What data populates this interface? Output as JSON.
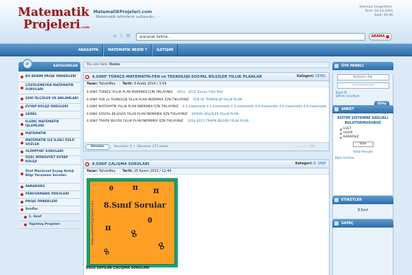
{
  "header": {
    "logo_line1": "Matematik",
    "logo_line2": "Projeleri",
    "logo_domain": ".com",
    "site_name": "MatematikProjeleri.com",
    "tagline": "- Matematik bilimlerin sultanıdır... -",
    "search_placeholder": "aranacak kelime...",
    "search_button": "ARAMA",
    "welcome": "Sitemize hoşgeldiniz.",
    "date": "Tarih: 04-24-2016",
    "time": "Saat: 04:46"
  },
  "nav": [
    "ANASAYFA",
    "MATEMATİK NEDİR ?",
    "İLETİŞİM"
  ],
  "left_panel": {
    "title": "KATEGORİLER",
    "items": [
      "BU BENİM PROJE ÖRNEKLERİ",
      "ÇÖZÜLEMEYEN MATEMATİK SORULARI",
      "ESKİ ÖLÇÜLER VE ANLAMLARI",
      "EVYAP KOLEJİ ÖDEVLERİ",
      "GENEL",
      "İLGİNÇ MATEMATİK İŞLEMLERİ",
      "MATEMATİK",
      "MATEMATİK İLE İLGİLİ ÖZLÜ SÖZLER",
      "OLİMPİYAT SORULARI",
      "ÖZEL MÜKÜVVET EVYAP KOLEJİ",
      "Özel Mürüvvet Evyap Koleji Bilgi Yarışması Soruları",
      "PARADOKS",
      "PERFORMANS ÖDEVLERİ",
      "PROJE ÖRNEKLERİ",
      "Sınıflar",
      "1. Sınıf",
      "Yapılmış Projeleri"
    ]
  },
  "breadcrumb": {
    "prefix": "You are here:",
    "home": "Home"
  },
  "post1": {
    "title": "4.SINIF TÜRKÇE-MATEMATİK-FEN ve TEKNOLOJİ-SOSYAL BİLGİLER YILLIK PLANLAR",
    "category_label": "Kategori:",
    "category": "GENEL",
    "author_label": "Yazar:",
    "author": "TahsinBey",
    "date_label": "Tarih:",
    "date": "9 Aralık 2014 / 1:54",
    "lines": [
      {
        "text": "4.SINIF TÜRKÇE YILLIK PLAN İNDİRMEK İÇİN TIKLAYINIZ",
        "link": "2014 - 2015 Türkçe Yıllık Plan"
      },
      {
        "text": "4.SINIF FEN ve TEKNOLOJİ YILLIK PLAN İNDİRMEK İÇİN TIKLAYINIZ",
        "link": "FEN VE TEKNOLOJİ YILLIK PLAN"
      },
      {
        "text": "4.SINIF MATEMATİK YILLIK PLAN İNDİRMEK İÇİN TIKLAYINIZ",
        "link": "4.1.matematik 4.2.matematik 4.3.matematik 4.4.matematik 4.5.matematik 4.6.matematik"
      },
      {
        "text": "4.SINIF SOSYAL BİLGİLER YILLIK PLAN İNDİRMEK İÇİN TIKLAYINIZ",
        "link": "SOSYAL BİLGİLER YILLIK PLAN"
      },
      {
        "text": "4.SINIF TRAFİK BİLGİSİ YILLIK PLAN İNDİRMEK İÇİN TIKLAYINIZ",
        "link": "2014-2015 TRAFİK BİLGİSİ YILLIK PLAN"
      }
    ],
    "more": "Devamı",
    "comments_label": "Yorumlar:",
    "comments": "0",
    "views_label": "Okunma:",
    "views": "277 views",
    "rating": "(No"
  },
  "post2": {
    "title": "8.SINIF ÇALIŞMA SORULARI",
    "category_label": "Kategori:",
    "category": "8. SINIF",
    "author_label": "Yazar:",
    "author": "TahsinBey",
    "date_label": "Tarih:",
    "date": "25 Kasım 2013 / 12:44",
    "image_text": "8.Sınıf Sorular",
    "image_watermark": "www.matematikprojeleri.com",
    "caption": "ÜSLÜ SAYILAR ÇALIŞMA SORULARI"
  },
  "member_panel": {
    "title": "ÜYE PANELİ",
    "username_placeholder": "Kullanıcı Adı",
    "password_mask": "••••••••••••",
    "register": "Kayıt Ol",
    "forgot": "Şifremi Unuttum",
    "login": "Giriş"
  },
  "poll": {
    "title": "ANKET",
    "question": "EĞİTİM SİSTEMİNİ SAĞLIKLI BULUYORMUSUNUZ",
    "options": [
      "EVET",
      "HAYIR",
      "KARARSIZ"
    ],
    "vote": "Vote",
    "results": "View Results",
    "archive": "Polls Archive"
  },
  "tags": {
    "title": "ETİKETLER",
    "items": [
      "8.Sınıf"
    ]
  },
  "counter": {
    "title": "SAYAÇ"
  }
}
